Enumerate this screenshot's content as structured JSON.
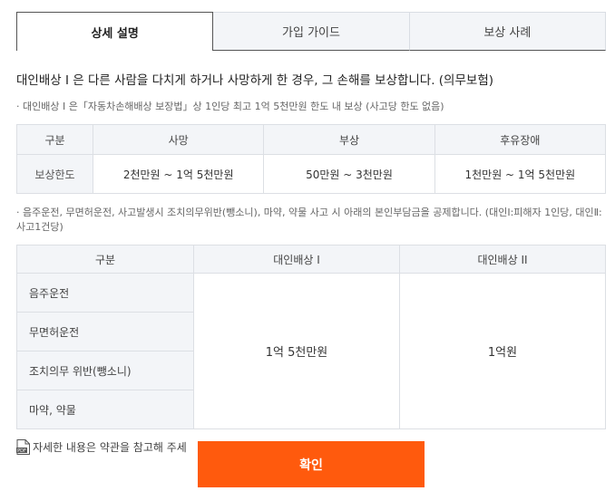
{
  "tabs": [
    {
      "label": "상세 설명",
      "active": true
    },
    {
      "label": "가입 가이드",
      "active": false
    },
    {
      "label": "보상 사례",
      "active": false
    }
  ],
  "headline": "대인배상 I 은 다른 사람을 다치게 하거나 사망하게 한 경우, 그 손해를 보상합니다. (의무보험)",
  "note1": "· 대인배상 I 은「자동차손해배상 보장법」상 1인당 최고 1억 5천만원 한도 내 보상 (사고당 한도 없음)",
  "limit_table": {
    "headers": [
      "구분",
      "사망",
      "부상",
      "후유장애"
    ],
    "row_label": "보상한도",
    "values": [
      "2천만원 ~ 1억 5천만원",
      "50만원 ~ 3천만원",
      "1천만원 ~ 1억 5천만원"
    ]
  },
  "note2": "· 음주운전, 무면허운전, 사고발생시 조치의무위반(뺑소니), 마약, 약물 사고 시 아래의 본인부담금을 공제합니다. (대인Ⅰ:피해자 1인당, 대인Ⅱ:사고1건당)",
  "deduct_table": {
    "headers": [
      "구분",
      "대인배상 I",
      "대인배상 II"
    ],
    "rows": [
      "음주운전",
      "무면허운전",
      "조치의무 위반(뺑소니)",
      "마약, 약물"
    ],
    "value1": "1억 5천만원",
    "value2": "1억원"
  },
  "pdf_link": "자세한 내용은 약관을 참고해 주세",
  "pdf_icon_text": "PDF",
  "confirm_label": "확인",
  "colors": {
    "accent": "#ff5a0d",
    "header_bg": "#f3f5f8"
  }
}
